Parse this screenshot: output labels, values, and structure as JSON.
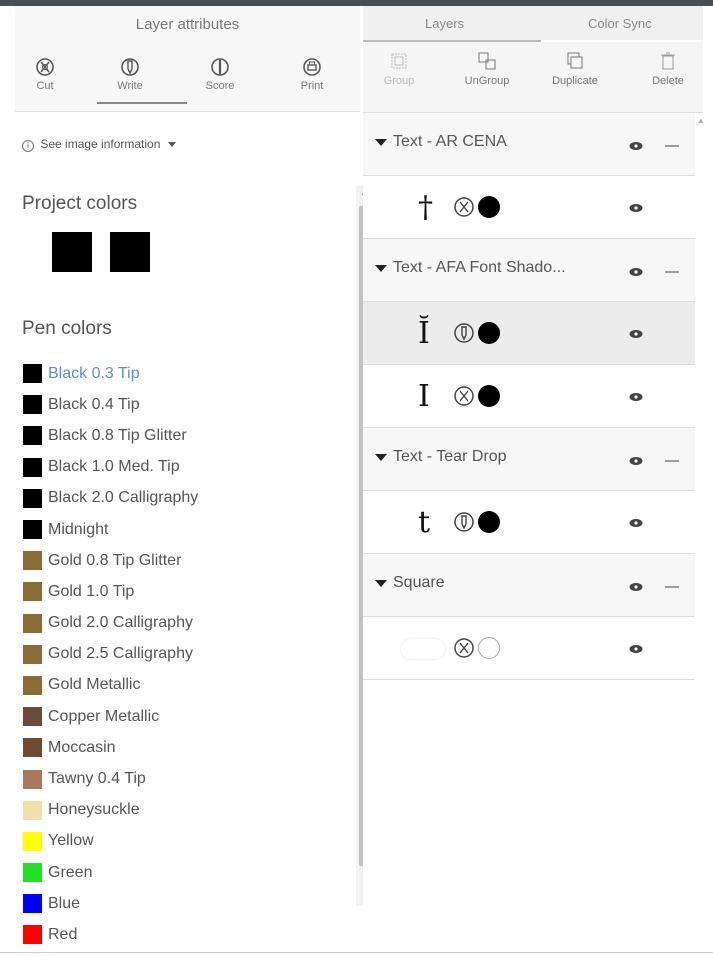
{
  "attributes": {
    "title": "Layer attributes",
    "ops": [
      {
        "label": "Cut",
        "icon": "cut-blade-icon"
      },
      {
        "label": "Write",
        "icon": "pen-icon"
      },
      {
        "label": "Score",
        "icon": "score-icon"
      },
      {
        "label": "Print",
        "icon": "printer-icon"
      }
    ],
    "selected_op": "Write",
    "info_label": "See image information",
    "project_colors_heading": "Project colors",
    "project_colors": [
      "#000000",
      "#000000"
    ],
    "pen_colors_heading": "Pen colors",
    "pen_colors": [
      {
        "label": "Black 0.3 Tip",
        "color": "#000000",
        "selected": true
      },
      {
        "label": "Black 0.4 Tip",
        "color": "#000000"
      },
      {
        "label": "Black 0.8 Tip Glitter",
        "color": "#000000"
      },
      {
        "label": "Black 1.0 Med. Tip",
        "color": "#000000"
      },
      {
        "label": "Black 2.0 Calligraphy",
        "color": "#000000"
      },
      {
        "label": "Midnight",
        "color": "#000000"
      },
      {
        "label": "Gold 0.8 Tip Glitter",
        "color": "#8a6d35"
      },
      {
        "label": "Gold 1.0 Tip",
        "color": "#8a6d35"
      },
      {
        "label": "Gold 2.0 Calligraphy",
        "color": "#8a6d35"
      },
      {
        "label": "Gold 2.5 Calligraphy",
        "color": "#8a6d35"
      },
      {
        "label": "Gold Metallic",
        "color": "#8a6d35"
      },
      {
        "label": "Copper Metallic",
        "color": "#6b4a3a"
      },
      {
        "label": "Moccasin",
        "color": "#6e4b2e"
      },
      {
        "label": "Tawny 0.4 Tip",
        "color": "#a8775c"
      },
      {
        "label": "Honeysuckle",
        "color": "#f0e0a8"
      },
      {
        "label": "Yellow",
        "color": "#ffff00"
      },
      {
        "label": "Green",
        "color": "#22e022"
      },
      {
        "label": "Blue",
        "color": "#0000ff"
      },
      {
        "label": "Red",
        "color": "#ff0000"
      }
    ]
  },
  "layers_panel": {
    "tabs": [
      {
        "label": "Layers",
        "active": true
      },
      {
        "label": "Color Sync",
        "active": false
      }
    ],
    "toolbar": [
      {
        "label": "Group",
        "icon": "group-icon",
        "disabled": true
      },
      {
        "label": "UnGroup",
        "icon": "ungroup-icon",
        "disabled": false
      },
      {
        "label": "Duplicate",
        "icon": "duplicate-icon",
        "disabled": false
      },
      {
        "label": "Delete",
        "icon": "trash-icon",
        "disabled": false
      }
    ],
    "groups": [
      {
        "name": "Text - AR CENA",
        "layers": [
          {
            "glyph": "†",
            "op": "cut",
            "color": "#000000",
            "selected": false
          }
        ]
      },
      {
        "name": "Text - AFA Font Shado...",
        "layers": [
          {
            "glyph": "Ĭ",
            "op": "write",
            "color": "#000000",
            "selected": true
          },
          {
            "glyph": "I",
            "op": "cut",
            "color": "#000000",
            "selected": false
          }
        ]
      },
      {
        "name": "Text - Tear Drop",
        "layers": [
          {
            "glyph": "t",
            "op": "write",
            "color": "#000000",
            "selected": false
          }
        ]
      },
      {
        "name": "Square",
        "layers": [
          {
            "glyph": "",
            "op": "cut",
            "color": "#ffffff",
            "selected": false
          }
        ]
      }
    ]
  }
}
